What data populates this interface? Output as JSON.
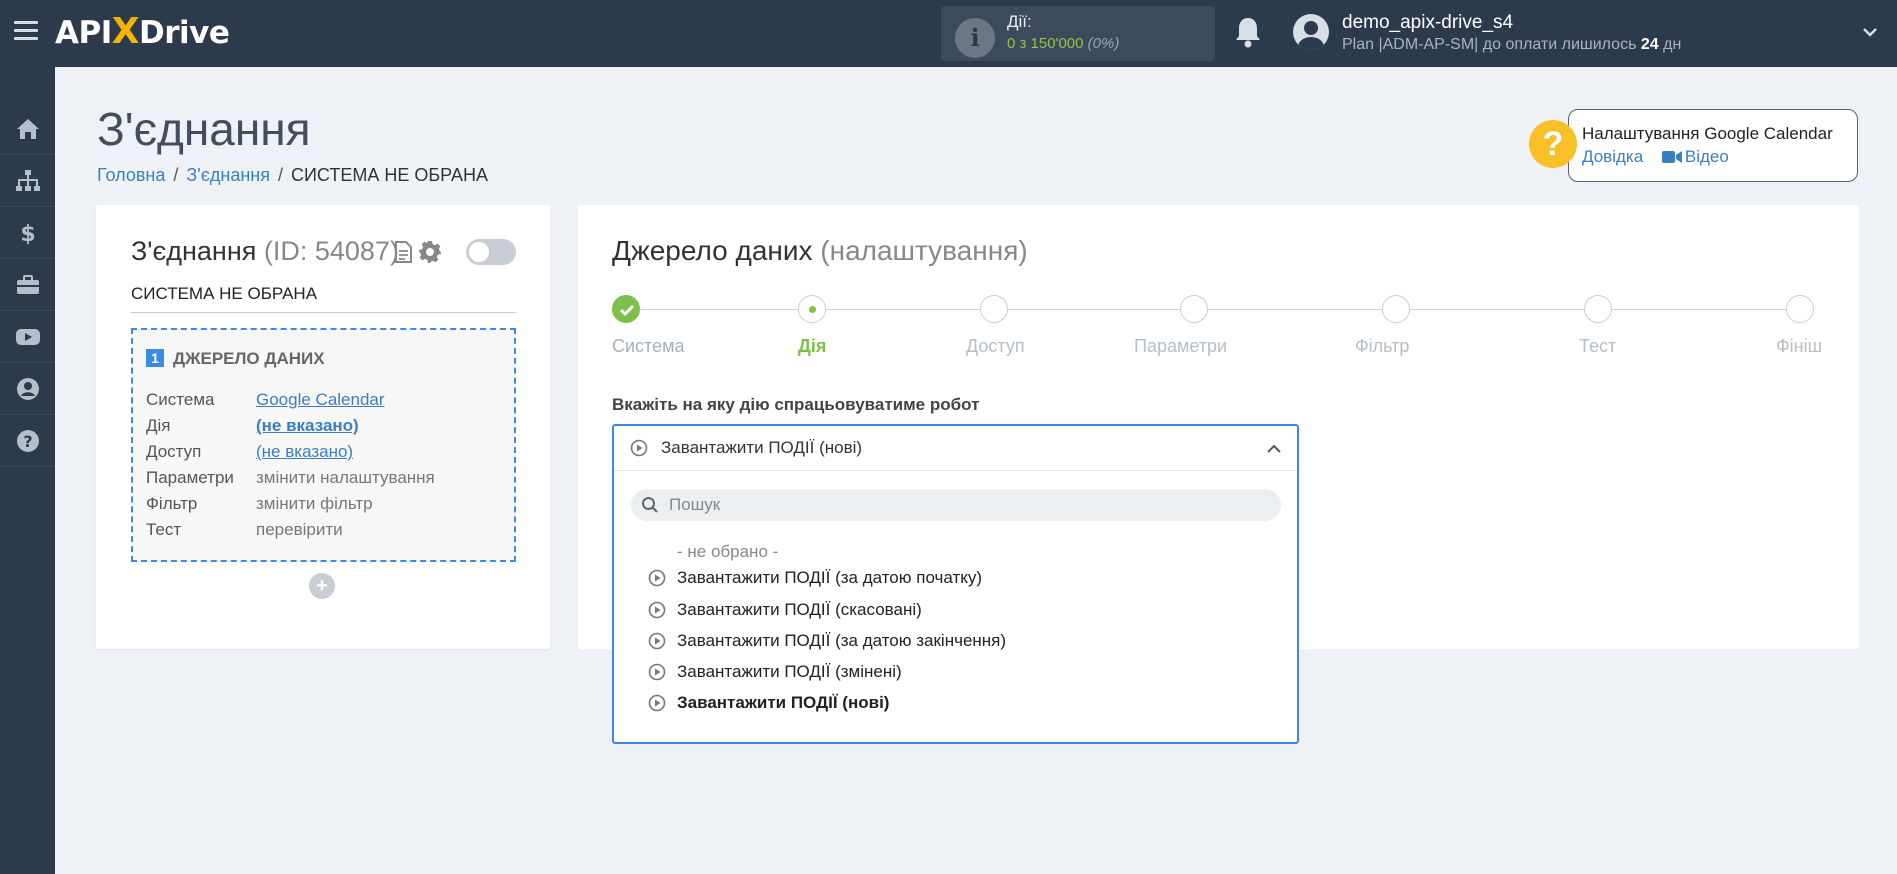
{
  "topbar": {
    "logo_text_a": "API",
    "logo_text_x": "X",
    "logo_text_b": "Drive",
    "actions_label": "Дії:",
    "actions_count": "0 з 150'000",
    "actions_pct": "(0%)",
    "username": "demo_apix-drive_s4",
    "plan_prefix": "Plan |ADM-AP-SM| до оплати лишилось ",
    "plan_days": "24",
    "plan_suffix": " дн"
  },
  "sidebar": {
    "items": [
      "home-icon",
      "sitemap-icon",
      "dollar-icon",
      "briefcase-icon",
      "youtube-icon",
      "user-icon",
      "help-icon"
    ]
  },
  "page": {
    "title": "З'єднання",
    "breadcrumb": {
      "home": "Головна",
      "connections": "З'єднання",
      "current": "СИСТЕМА НЕ ОБРАНА"
    }
  },
  "help": {
    "q": "?",
    "title": "Налаштування Google Calendar",
    "docs_link": "Довідка",
    "video_link": "Відео"
  },
  "connection": {
    "title": "З'єднання",
    "id_label": "(ID: 54087)",
    "system_name": "СИСТЕМА НЕ ОБРАНА",
    "source": {
      "num": "1",
      "title": "ДЖЕРЕЛО ДАНИХ",
      "rows": [
        {
          "key": "Система",
          "value": "Google Calendar"
        },
        {
          "key": "Дія",
          "value": "(не вказано)"
        },
        {
          "key": "Доступ",
          "value": "(не вказано)"
        },
        {
          "key": "Параметри",
          "value": "змінити налаштування"
        },
        {
          "key": "Фільтр",
          "value": "змінити фільтр"
        },
        {
          "key": "Тест",
          "value": "перевірити"
        }
      ]
    },
    "add_label": "+"
  },
  "datasource": {
    "title": "Джерело даних",
    "subtitle": "(налаштування)",
    "steps": [
      "Система",
      "Дія",
      "Доступ",
      "Параметри",
      "Фільтр",
      "Тест",
      "Фініш"
    ],
    "field_label": "Вкажіть на яку дію спрацьовуватиме робот",
    "dropdown": {
      "selected": "Завантажити ПОДІЇ (нові)",
      "search_placeholder": "Пошук",
      "options": [
        "- не обрано -",
        "Завантажити ПОДІЇ (за датою початку)",
        "Завантажити ПОДІЇ (скасовані)",
        "Завантажити ПОДІЇ (за датою закінчення)",
        "Завантажити ПОДІЇ (змінені)",
        "Завантажити ПОДІЇ (нові)"
      ]
    }
  },
  "colors": {
    "topbar": "#2c3a4b",
    "accent_blue": "#3a8be8",
    "link": "#3a7fc1",
    "success_green": "#7cc04b",
    "help_yellow": "#f9bf26"
  }
}
